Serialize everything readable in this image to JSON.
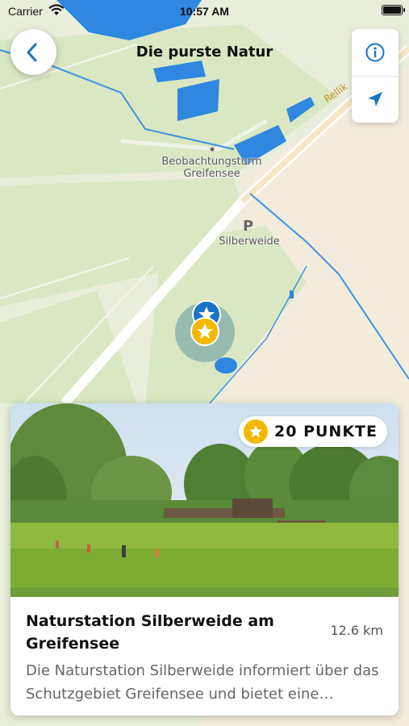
{
  "status_bar": {
    "carrier": "Carrier",
    "time": "10:57 AM"
  },
  "header": {
    "title": "Die purste Natur"
  },
  "map": {
    "labels": {
      "tower_line1": "Beobachtungsturm",
      "tower_line2": "Greifensee",
      "parking": "P",
      "parking_name": "Silberweide",
      "road": "Rellik"
    }
  },
  "card": {
    "points_badge": "20 PUNKTE",
    "title": "Naturstation Silberweide am Greifensee",
    "distance": "12.6 km",
    "description": "Die Naturstation Silberweide informiert über das Schutzgebiet Greifensee und bietet eine…"
  },
  "colors": {
    "accent": "#1a74c4",
    "star": "#f5b800",
    "water": "#2f87e0",
    "land": "#e9eedb",
    "park": "#d6e6bd"
  }
}
